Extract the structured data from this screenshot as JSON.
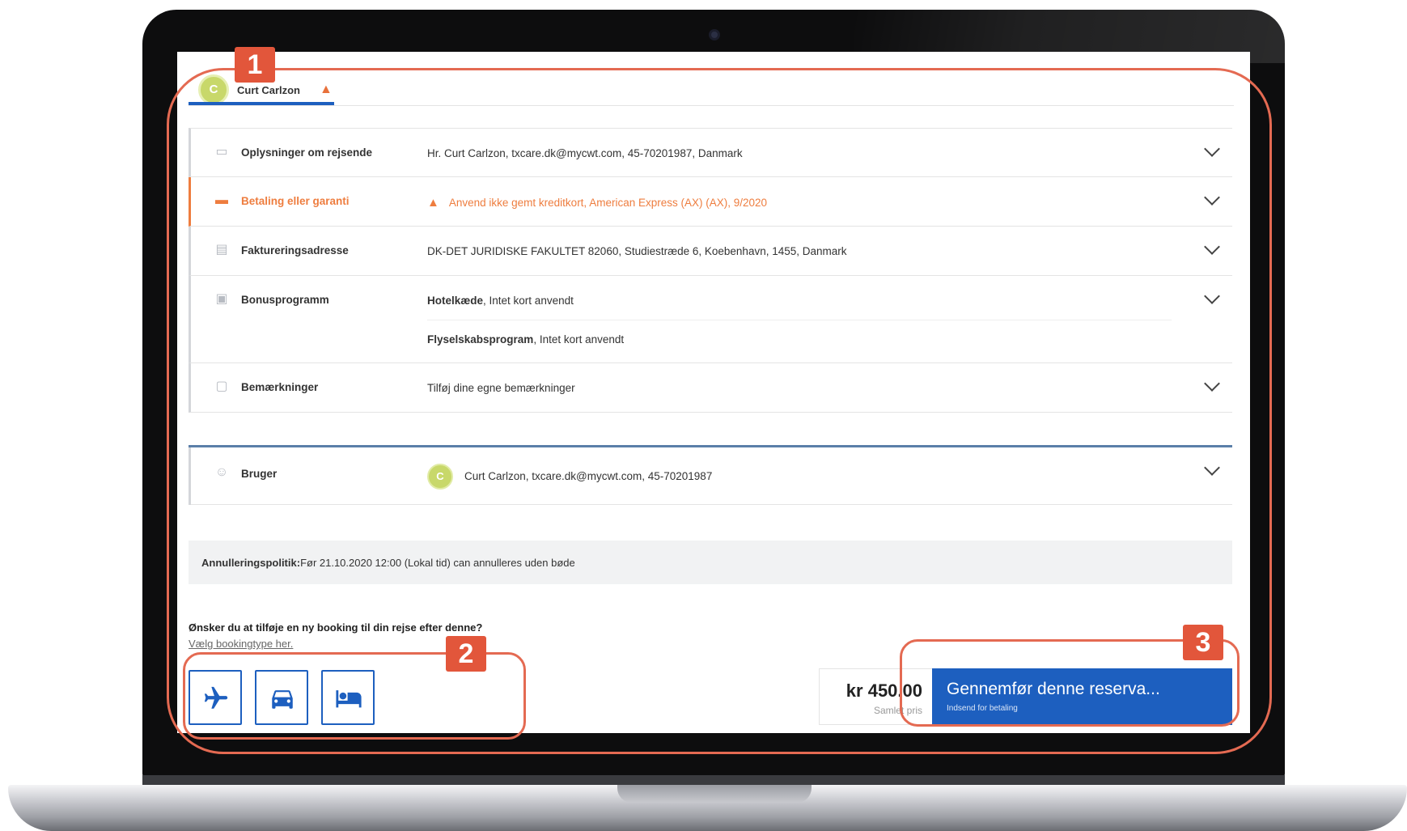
{
  "tab": {
    "avatar_initial": "C",
    "name": "Curt Carlzon",
    "warning_icon": "warning-triangle-icon"
  },
  "rows": [
    {
      "icon": "traveler-card-icon",
      "label": "Oplysninger om rejsende",
      "value": "Hr. Curt Carlzon, txcare.dk@mycwt.com, 45-70201987, Danmark"
    },
    {
      "icon": "credit-card-icon",
      "label": "Betaling eller garanti",
      "value": "Anvend ikke gemt kreditkort, American Express (AX) (AX), 9/2020"
    },
    {
      "icon": "document-icon",
      "label": "Faktureringsadresse",
      "value": "DK-DET JURIDISKE FAKULTET 82060, Studiestræde 6, Koebenhavn, 1455, Danmark"
    },
    {
      "icon": "membership-card-icon",
      "label": "Bonusprogramm",
      "value_bold": "Hotelkæde",
      "value_rest": ", Intet kort anvendt",
      "value2_bold": "Flyselskabsprogram",
      "value2_rest": ", Intet kort anvendt"
    },
    {
      "icon": "comment-icon",
      "label": "Bemærkninger",
      "value": "Tilføj dine egne bemærkninger"
    }
  ],
  "user": {
    "icon": "user-icon",
    "label": "Bruger",
    "avatar_initial": "C",
    "value": "Curt Carlzon, txcare.dk@mycwt.com, 45-70201987"
  },
  "policy": {
    "label": "Annulleringspolitik:",
    "text": "Før 21.10.2020 12:00 (Lokal tid) can annulleres uden bøde"
  },
  "add_booking": {
    "question": "Ønsker du at tilføje en ny booking til din rejse efter denne?",
    "sub": "Vælg bookingtype her.",
    "types": [
      "flight",
      "car",
      "hotel"
    ]
  },
  "price": {
    "amount": "kr 450.00",
    "label": "Samlet pris"
  },
  "cta": {
    "title": "Gennemfør denne reserva...",
    "subtitle": "Indsend for betaling"
  },
  "annotations": [
    "1",
    "2",
    "3"
  ],
  "colors": {
    "accent": "#1d5fbf",
    "warning": "#ee7d3f",
    "annotation": "#e2563b",
    "avatar": "#c8d86a"
  }
}
